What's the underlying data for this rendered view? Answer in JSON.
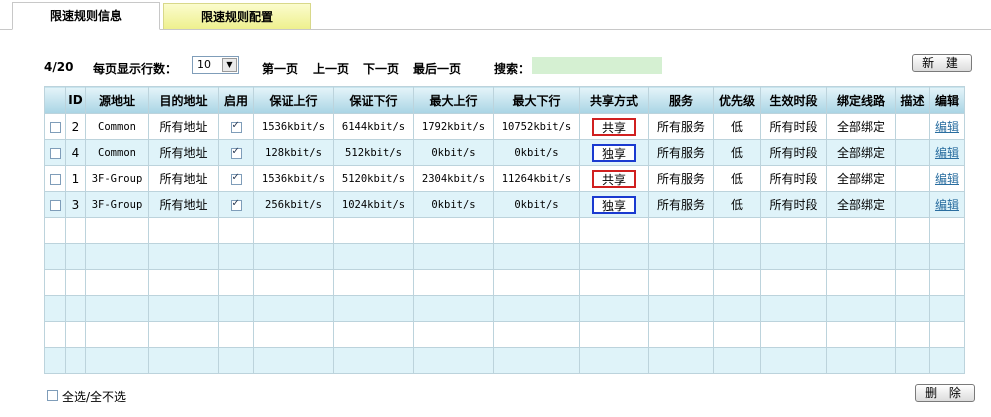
{
  "tabs": [
    {
      "label": "限速规则信息",
      "active": true
    },
    {
      "label": "限速规则配置",
      "active": false
    }
  ],
  "toolbar": {
    "page_indicator": "4/20",
    "rows_per_page_label": "每页显示行数：",
    "rows_per_page_value": "10",
    "first_page": "第一页",
    "prev_page": "上一页",
    "next_page": "下一页",
    "last_page": "最后一页",
    "search_label": "搜索：",
    "search_value": "",
    "new_button": "新 建"
  },
  "table": {
    "headers": [
      "",
      "ID",
      "源地址",
      "目的地址",
      "启用",
      "保证上行",
      "保证下行",
      "最大上行",
      "最大下行",
      "共享方式",
      "服务",
      "优先级",
      "生效时段",
      "绑定线路",
      "描述",
      "编辑"
    ],
    "rows": [
      {
        "id": "2",
        "src": "Common",
        "dst": "所有地址",
        "enabled": true,
        "guar_up": "1536kbit/s",
        "guar_down": "6144kbit/s",
        "max_up": "1792kbit/s",
        "max_down": "10752kbit/s",
        "share": "共享",
        "service": "所有服务",
        "priority": "低",
        "period": "所有时段",
        "line": "全部绑定",
        "desc": "",
        "edit": "编辑"
      },
      {
        "id": "4",
        "src": "Common",
        "dst": "所有地址",
        "enabled": true,
        "guar_up": "128kbit/s",
        "guar_down": "512kbit/s",
        "max_up": "0kbit/s",
        "max_down": "0kbit/s",
        "share": "独享",
        "service": "所有服务",
        "priority": "低",
        "period": "所有时段",
        "line": "全部绑定",
        "desc": "",
        "edit": "编辑"
      },
      {
        "id": "1",
        "src": "3F-Group",
        "dst": "所有地址",
        "enabled": true,
        "guar_up": "1536kbit/s",
        "guar_down": "5120kbit/s",
        "max_up": "2304kbit/s",
        "max_down": "11264kbit/s",
        "share": "共享",
        "service": "所有服务",
        "priority": "低",
        "period": "所有时段",
        "line": "全部绑定",
        "desc": "",
        "edit": "编辑"
      },
      {
        "id": "3",
        "src": "3F-Group",
        "dst": "所有地址",
        "enabled": true,
        "guar_up": "256kbit/s",
        "guar_down": "1024kbit/s",
        "max_up": "0kbit/s",
        "max_down": "0kbit/s",
        "share": "独享",
        "service": "所有服务",
        "priority": "低",
        "period": "所有时段",
        "line": "全部绑定",
        "desc": "",
        "edit": "编辑"
      }
    ]
  },
  "footer": {
    "select_all_label": "全选/全不选",
    "delete_button": "删 除"
  },
  "colors": {
    "shared_border": "#d02020",
    "exclusive_border": "#1a3ad0",
    "row_alt": "#dff3f9",
    "header_bg": "#a9d4e4",
    "search_bg": "#d5f0d2"
  }
}
